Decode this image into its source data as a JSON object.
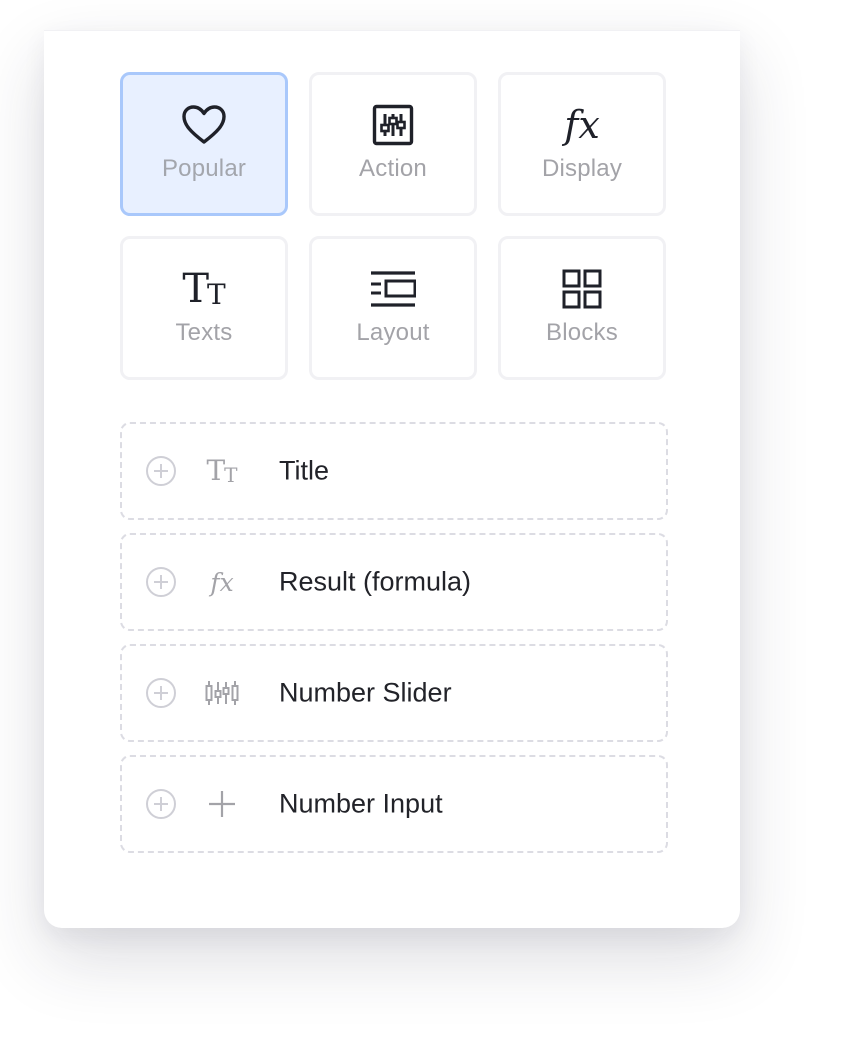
{
  "categories": [
    {
      "label": "Popular",
      "icon": "heart-icon",
      "active": true
    },
    {
      "label": "Action",
      "icon": "sliders-icon",
      "active": false
    },
    {
      "label": "Display",
      "icon": "fx-icon",
      "active": false
    },
    {
      "label": "Texts",
      "icon": "text-icon",
      "active": false
    },
    {
      "label": "Layout",
      "icon": "layout-icon",
      "active": false
    },
    {
      "label": "Blocks",
      "icon": "blocks-icon",
      "active": false
    }
  ],
  "glyphs": {
    "fx": "fx",
    "tt_big": "T",
    "tt_small": "T"
  },
  "components": [
    {
      "label": "Title",
      "icon": "text-icon"
    },
    {
      "label": "Result (formula)",
      "icon": "fx-icon"
    },
    {
      "label": "Number Slider",
      "icon": "slider-icon"
    },
    {
      "label": "Number Input",
      "icon": "plus-icon"
    }
  ],
  "colors": {
    "active_bg": "#e8f0ff",
    "active_border": "#a9c8fb",
    "icon_dark": "#1f2129",
    "muted": "#a3a3a8",
    "dashed_border": "#dcdce3"
  }
}
